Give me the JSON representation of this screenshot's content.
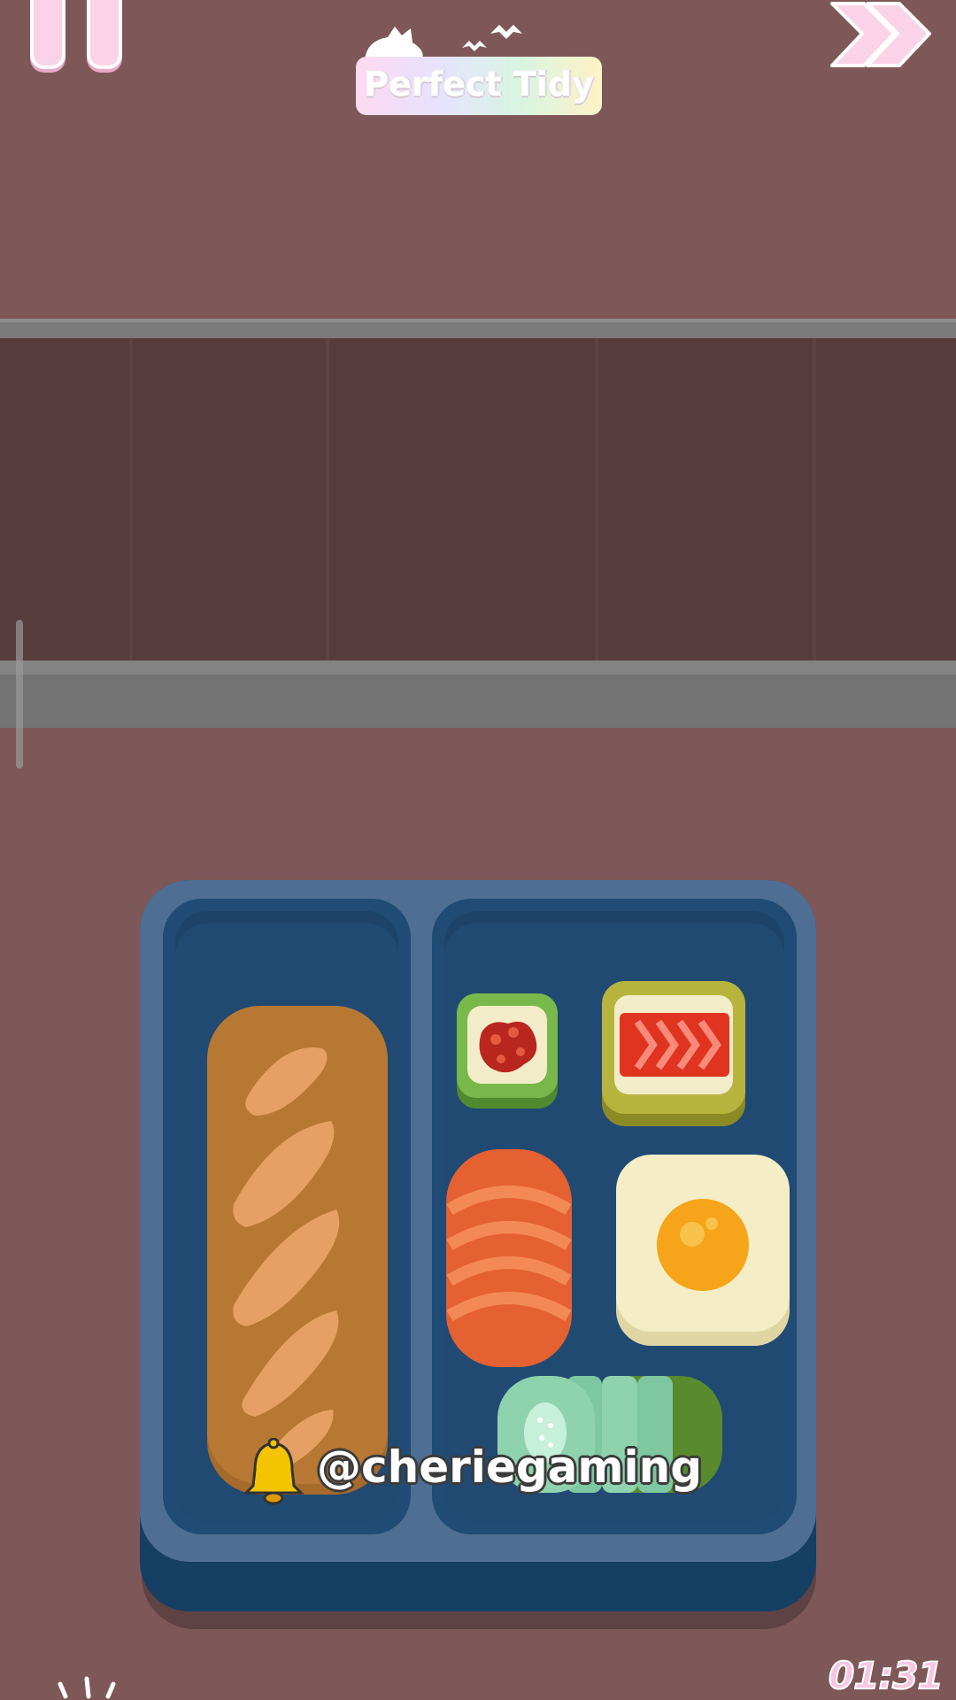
{
  "header": {
    "logo_text": "Perfect Tidy",
    "pause_icon": "pause-icon",
    "skip_icon": "fast-forward-icon"
  },
  "hud": {
    "timer": "01:31"
  },
  "watermark": {
    "bell_icon": "bell-icon",
    "text": "@cheriegaming"
  },
  "scene": {
    "shelf": "wall-shelf",
    "tray": "bento-box",
    "items": [
      "baguette",
      "sushi-roll-small",
      "salmon-sushi-roll",
      "salmon-slices",
      "fried-egg",
      "cucumber-slices"
    ]
  },
  "colors": {
    "background": "#7e5858",
    "wall": "#573b3d",
    "tray_rim": "#4f6e93",
    "tray_inner": "#1f4b74",
    "accent_pink": "#fbd3e6"
  }
}
